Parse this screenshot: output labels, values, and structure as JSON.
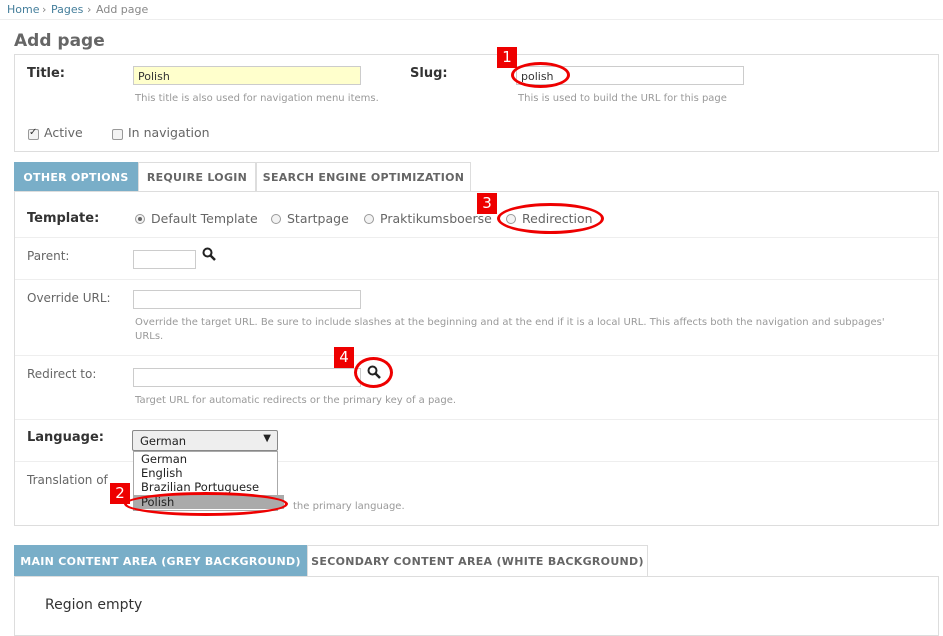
{
  "breadcrumbs": {
    "home": "Home",
    "sep": "›",
    "pages": "Pages",
    "current": "Add page"
  },
  "page_title": "Add page",
  "general": {
    "title_label": "Title:",
    "title_value": "Polish",
    "title_help": "This title is also used for navigation menu items.",
    "slug_label": "Slug:",
    "slug_value": "polish",
    "slug_help": "This is used to build the URL for this page",
    "active_label": "Active",
    "active_checked": true,
    "in_navigation_label": "In navigation",
    "in_navigation_checked": false
  },
  "option_tabs": [
    "OTHER OPTIONS",
    "REQUIRE LOGIN",
    "SEARCH ENGINE OPTIMIZATION"
  ],
  "other_options": {
    "template_label": "Template:",
    "templates": [
      "Default Template",
      "Startpage",
      "Praktikumsboerse",
      "Redirection"
    ],
    "template_selected": "Default Template",
    "parent_label": "Parent:",
    "override_url_label": "Override URL:",
    "override_url_help": "Override the target URL. Be sure to include slashes at the beginning and at the end if it is a local URL. This affects both the navigation and subpages' URLs.",
    "redirect_label": "Redirect to:",
    "redirect_help": "Target URL for automatic redirects or the primary key of a page.",
    "language_label": "Language:",
    "language_selected": "German",
    "language_options": [
      "German",
      "English",
      "Brazilian Portuguese",
      "Polish"
    ],
    "language_highlighted": "Polish",
    "translation_label": "Translation of",
    "translation_help_visible": "the primary language."
  },
  "content_tabs": [
    "MAIN CONTENT AREA (GREY BACKGROUND)",
    "SECONDARY CONTENT AREA (WHITE BACKGROUND)"
  ],
  "region_empty": "Region empty",
  "annotations": [
    "1",
    "2",
    "3",
    "4"
  ],
  "colors": {
    "accent": "#79aec8",
    "link": "#447e9b",
    "highlight_input": "#ffffcc",
    "annotation_red": "#e00000"
  }
}
